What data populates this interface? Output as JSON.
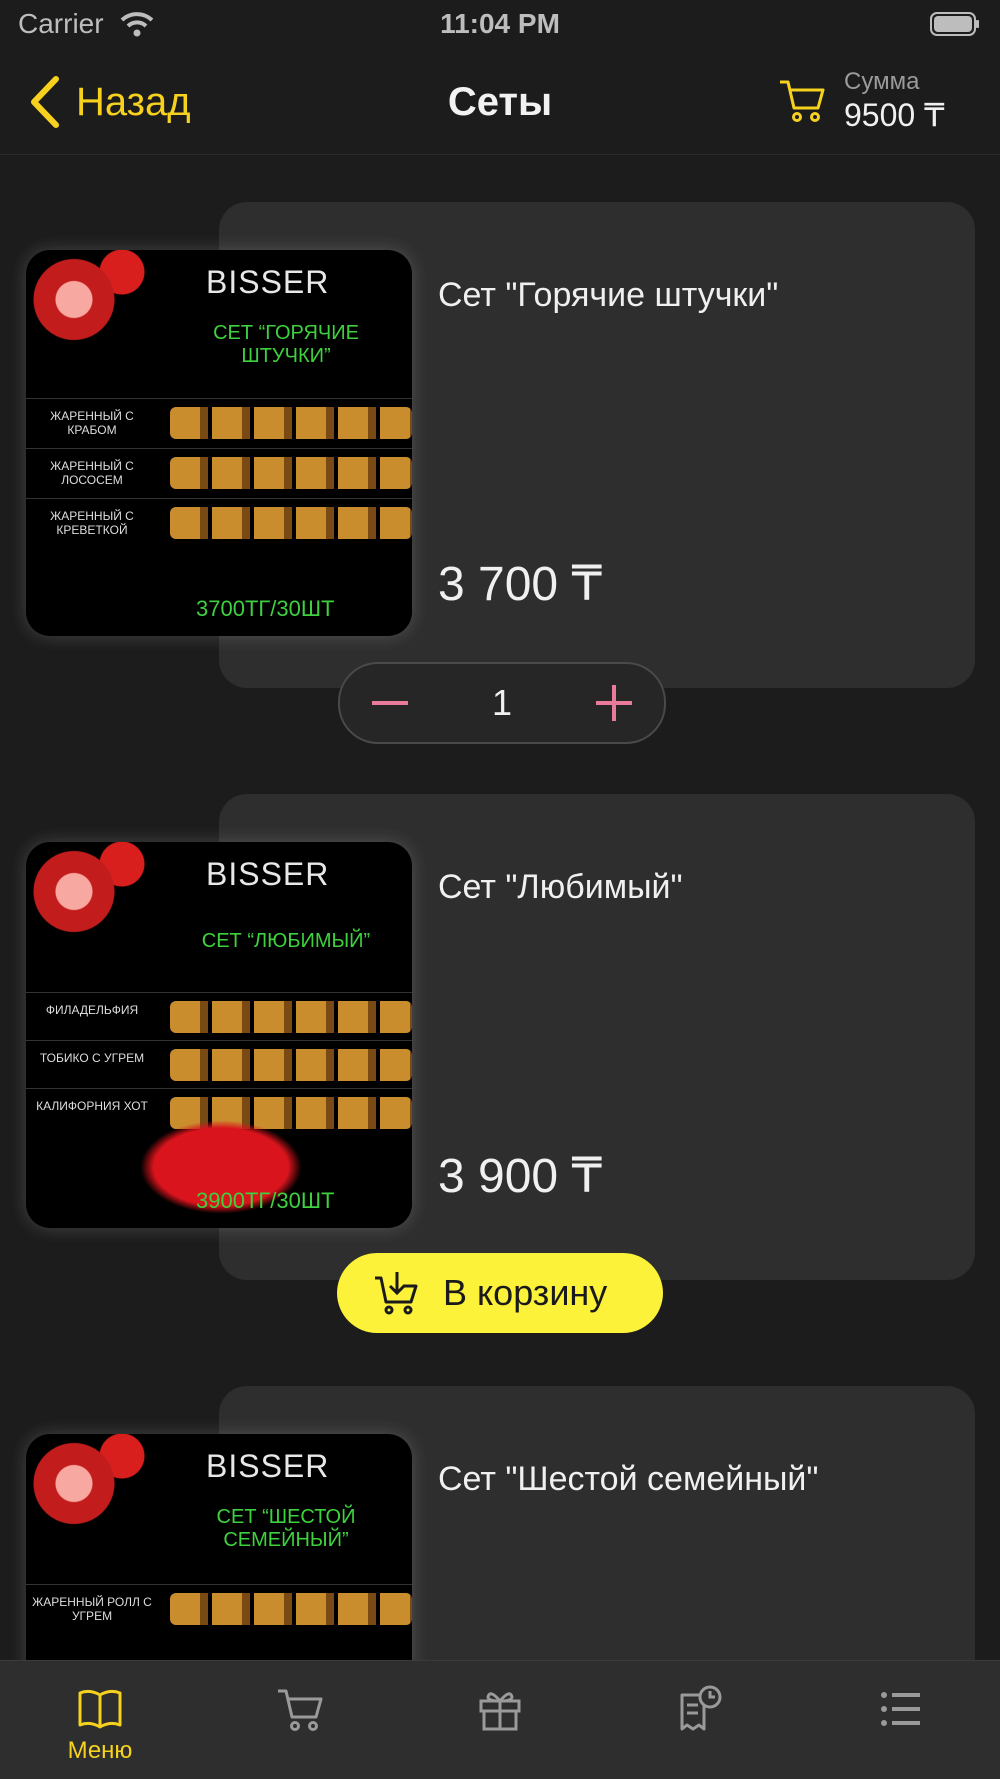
{
  "status_bar": {
    "carrier": "Carrier",
    "time": "11:04 PM"
  },
  "nav": {
    "back_label": "Назад",
    "title": "Сеты",
    "cart_sum_label": "Сумма",
    "cart_sum_value": "9500 ₸"
  },
  "colors": {
    "accent": "#f6d21e",
    "add_button": "#fcf23a",
    "stepper_icons": "#e87a9a",
    "card_bg": "#2e2e2e",
    "page_bg": "#1c1c1c"
  },
  "products": [
    {
      "name": "Сет \"Горячие штучки\"",
      "price": "3 700 ₸",
      "quantity": "1",
      "image": {
        "brand": "BISSER",
        "title": "СЕТ “ГОРЯЧИЕ ШТУЧКИ”",
        "rows": [
          "ЖАРЕННЫЙ С КРАБОМ",
          "ЖАРЕННЫЙ С ЛОСОСЕМ",
          "ЖАРЕННЫЙ С КРЕВЕТКОЙ"
        ],
        "footer": "3700ТГ/30ШТ"
      }
    },
    {
      "name": "Сет \"Любимый\"",
      "price": "3 900 ₸",
      "add_label": "В корзину",
      "image": {
        "brand": "BISSER",
        "title": "СЕТ “ЛЮБИМЫЙ”",
        "rows": [
          "ФИЛАДЕЛЬФИЯ",
          "ТОБИКО С УГРЕМ",
          "КАЛИФОРНИЯ ХОТ"
        ],
        "footer": "3900ТГ/30ШТ"
      }
    },
    {
      "name": "Сет \"Шестой семейный\"",
      "image": {
        "brand": "BISSER",
        "title": "СЕТ “ШЕСТОЙ СЕМЕЙНЫЙ”",
        "rows": [
          "ЖАРЕННЫЙ РОЛЛ С УГРЕМ"
        ]
      }
    }
  ],
  "tabbar": {
    "items": [
      {
        "icon": "book-icon",
        "label": "Меню",
        "active": true
      },
      {
        "icon": "cart-icon"
      },
      {
        "icon": "gift-icon"
      },
      {
        "icon": "receipt-clock-icon"
      },
      {
        "icon": "list-icon"
      }
    ]
  }
}
